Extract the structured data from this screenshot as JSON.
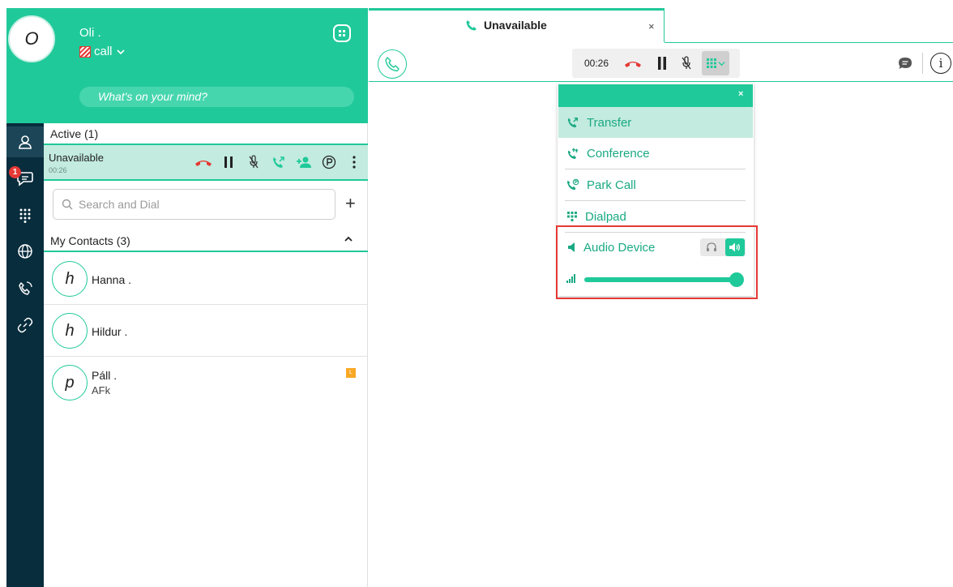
{
  "profile": {
    "avatar_initial": "O",
    "name": "Oli .",
    "status": "call",
    "mind_placeholder": "What's on your mind?"
  },
  "rail": {
    "chat_badge": "1"
  },
  "active_section": {
    "title": "Active (1)",
    "call": {
      "name": "Unavailable",
      "time": "00:26"
    }
  },
  "search": {
    "placeholder": "Search and Dial"
  },
  "contacts": {
    "title": "My Contacts (3)",
    "items": [
      {
        "initial": "h",
        "name": "Hanna .",
        "sub": ""
      },
      {
        "initial": "h",
        "name": "Hildur .",
        "sub": ""
      },
      {
        "initial": "p",
        "name": "Páll .",
        "sub": "AFk",
        "tag": "L"
      }
    ]
  },
  "tab": {
    "label": "Unavailable",
    "close": "×"
  },
  "call_bar": {
    "time": "00:26"
  },
  "menu": {
    "close": "×",
    "items": [
      {
        "label": "Transfer",
        "icon": "phone-transfer-icon"
      },
      {
        "label": "Conference",
        "icon": "conference-icon"
      },
      {
        "label": "Park Call",
        "icon": "park-call-icon"
      },
      {
        "label": "Dialpad",
        "icon": "dialpad-icon"
      }
    ],
    "audio_device_label": "Audio Device",
    "volume": 0.98
  },
  "colors": {
    "accent": "#20c99a",
    "accent_text": "#1aa983",
    "rail": "#082d3d",
    "highlight": "#e53935",
    "hangup": "#e53935"
  }
}
